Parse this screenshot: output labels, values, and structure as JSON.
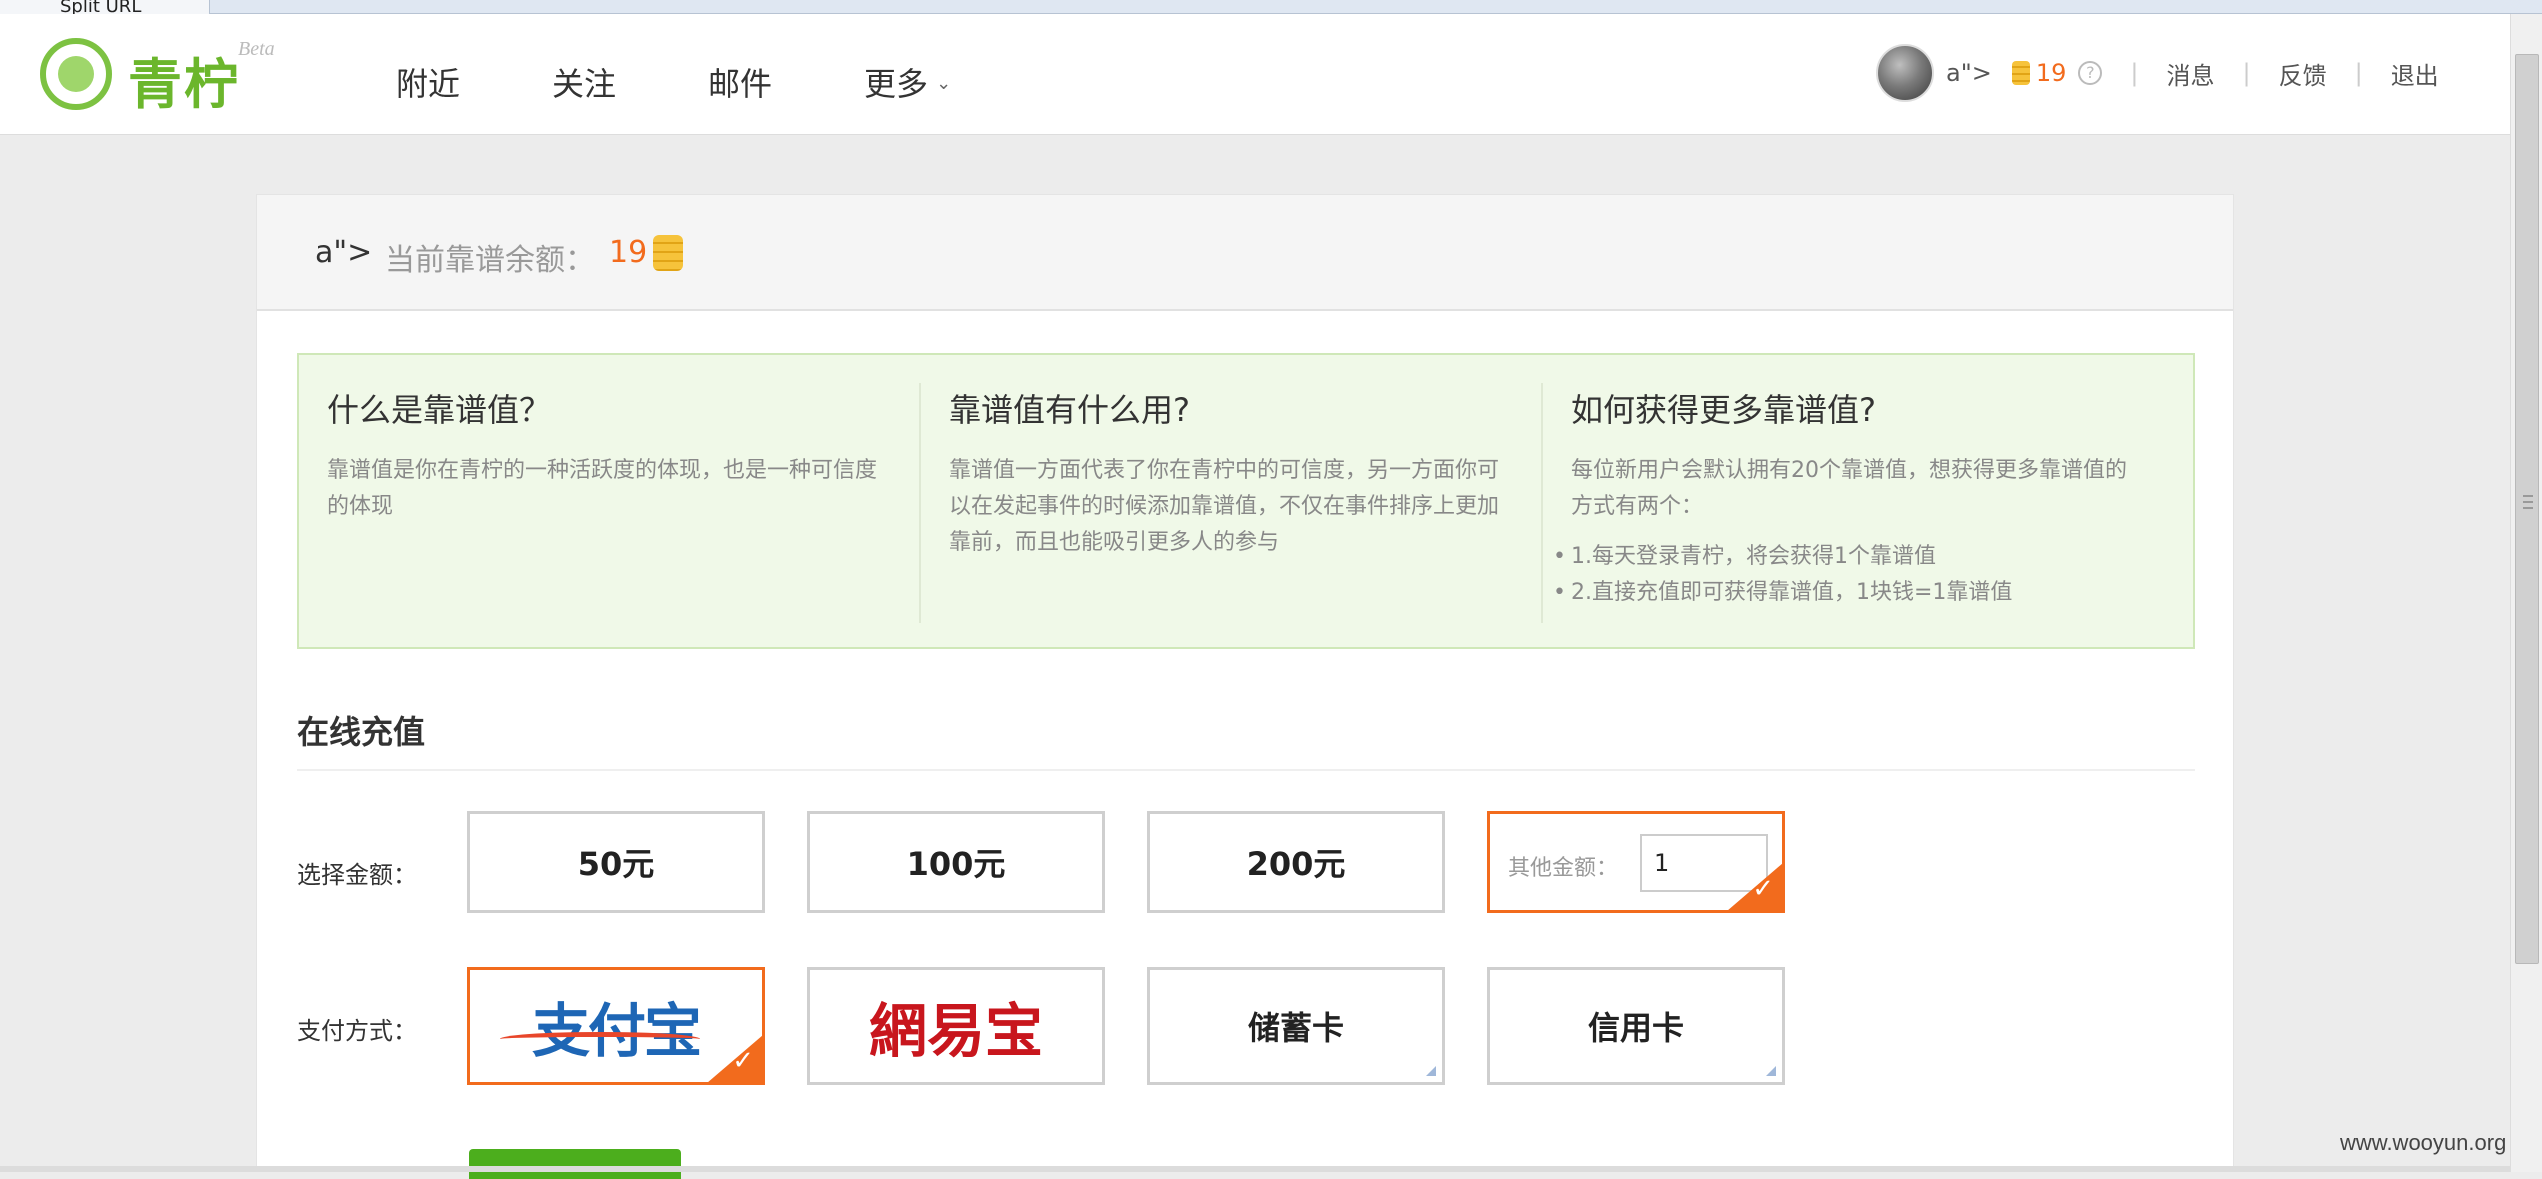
{
  "browser": {
    "tab_label": "Split URL"
  },
  "header": {
    "logo_text": "青柠",
    "logo_badge": "Beta",
    "nav": [
      {
        "label": "附近"
      },
      {
        "label": "关注"
      },
      {
        "label": "邮件"
      },
      {
        "label": "更多"
      }
    ],
    "user": {
      "name": "a\">",
      "coins": "19",
      "help": "?"
    },
    "links": [
      "消息",
      "反馈",
      "退出"
    ],
    "separator": "|"
  },
  "balance": {
    "user_name": "a\">",
    "label": "当前靠谱余额：",
    "value": "19"
  },
  "info": [
    {
      "title": "什么是靠谱值？",
      "body": "靠谱值是你在青柠的一种活跃度的体现，也是一种可信度的体现"
    },
    {
      "title": "靠谱值有什么用?",
      "body": "靠谱值一方面代表了你在青柠中的可信度，另一方面你可以在发起事件的时候添加靠谱值，不仅在事件排序上更加靠前，而且也能吸引更多人的参与"
    },
    {
      "title": "如何获得更多靠谱值?",
      "body": "每位新用户会默认拥有20个靠谱值，想获得更多靠谱值的方式有两个：",
      "items": [
        "1.每天登录青柠，将会获得1个靠谱值",
        "2.直接充值即可获得靠谱值，1块钱=1靠谱值"
      ]
    }
  ],
  "recharge": {
    "title": "在线充值",
    "amount_label": "选择金额：",
    "amounts": [
      "50元",
      "100元",
      "200元"
    ],
    "other_label": "其他金额：",
    "other_value": "1",
    "selected_amount": "other",
    "payment_label": "支付方式：",
    "payments": [
      {
        "name": "alipay",
        "label": "支付宝",
        "selected": true
      },
      {
        "name": "netease",
        "label": "網易宝",
        "selected": false
      },
      {
        "name": "debit",
        "label": "储蓄卡",
        "selected": false
      },
      {
        "name": "credit",
        "label": "信用卡",
        "selected": false
      }
    ],
    "checkmark": "✓"
  },
  "watermark": "www.wooyun.org",
  "colors": {
    "accent": "#f26b1d",
    "brand_green": "#6bb62c",
    "info_bg": "#f0f9e8",
    "alipay_blue": "#1e66b5",
    "netease_red": "#c8161d"
  }
}
